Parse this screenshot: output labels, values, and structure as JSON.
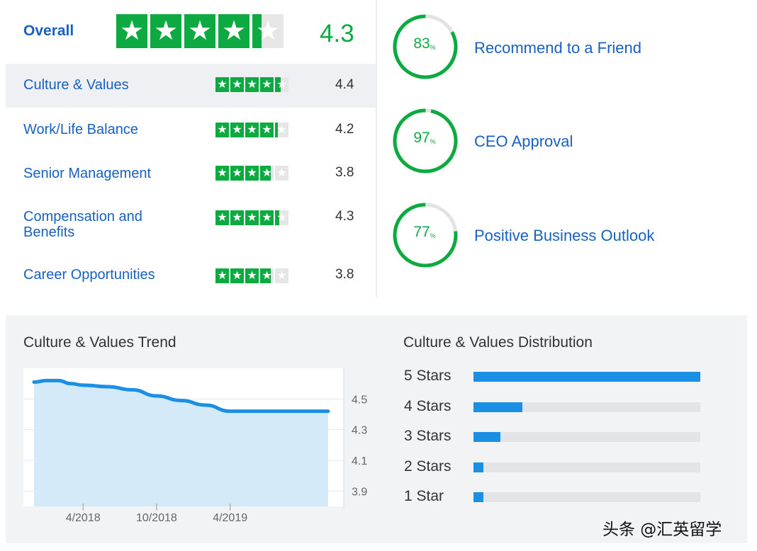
{
  "ratings": {
    "overall": {
      "label": "Overall",
      "value": "4.3",
      "rating": 4.3
    },
    "categories": [
      {
        "label": "Culture & Values",
        "value": "4.4",
        "rating": 4.4
      },
      {
        "label": "Work/Life Balance",
        "value": "4.2",
        "rating": 4.2
      },
      {
        "label": "Senior Management",
        "value": "3.8",
        "rating": 3.8
      },
      {
        "label": "Compensation and Benefits",
        "value": "4.3",
        "rating": 4.3
      },
      {
        "label": "Career Opportunities",
        "value": "3.8",
        "rating": 3.8
      }
    ],
    "star_color": "#0caa41",
    "star_empty_color": "#e6e6e6",
    "star_icon": "star-icon"
  },
  "circles": [
    {
      "value": "83",
      "percent": 83,
      "unit": "%",
      "label": "Recommend to a Friend"
    },
    {
      "value": "97",
      "percent": 97,
      "unit": "%",
      "label": "CEO Approval"
    },
    {
      "value": "77",
      "percent": 77,
      "unit": "%",
      "label": "Positive Business Outlook"
    }
  ],
  "trend": {
    "title": "Culture & Values Trend",
    "x_ticks": [
      "4/2018",
      "10/2018",
      "4/2019"
    ],
    "y_ticks": [
      "4.5",
      "4.3",
      "4.1",
      "3.9"
    ]
  },
  "distribution": {
    "title": "Culture & Values Distribution",
    "bar_color": "#1b8fe3"
  },
  "chart_data": [
    {
      "type": "area",
      "title": "Culture & Values Trend",
      "x": [
        "2017-12",
        "2018-01",
        "2018-02",
        "2018-03",
        "2018-04",
        "2018-06",
        "2018-08",
        "2018-10",
        "2018-12",
        "2019-02",
        "2019-04",
        "2019-06",
        "2019-08",
        "2019-10",
        "2019-12"
      ],
      "values": [
        4.61,
        4.62,
        4.62,
        4.6,
        4.59,
        4.58,
        4.56,
        4.52,
        4.49,
        4.46,
        4.42,
        4.42,
        4.42,
        4.42,
        4.42
      ],
      "ylim": [
        3.8,
        4.7
      ],
      "y_ticks": [
        4.5,
        4.3,
        4.1,
        3.9
      ],
      "x_ticks": [
        "4/2018",
        "10/2018",
        "4/2019"
      ],
      "grid": true
    },
    {
      "type": "bar",
      "title": "Culture & Values Distribution",
      "orientation": "horizontal",
      "categories": [
        "5 Stars",
        "4 Stars",
        "3 Stars",
        "2 Stars",
        "1 Star"
      ],
      "values": [
        100,
        21.5,
        12,
        4.5,
        4.5
      ],
      "xlim": [
        0,
        100
      ]
    }
  ],
  "watermark": "头条 @汇英留学"
}
